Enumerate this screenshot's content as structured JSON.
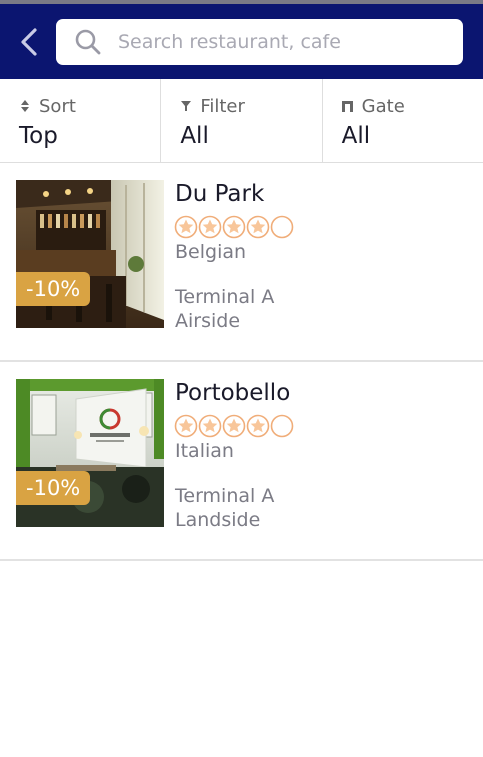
{
  "header": {
    "back_icon": "chevron-left-icon",
    "search_icon": "search-icon",
    "search_placeholder": "Search restaurant, cafe",
    "search_value": "",
    "bg_color": "#0b1570"
  },
  "filters": {
    "sort": {
      "label": "Sort",
      "value": "Top",
      "icon": "sort-icon"
    },
    "filter": {
      "label": "Filter",
      "value": "All",
      "icon": "filter-icon"
    },
    "gate": {
      "label": "Gate",
      "value": "All",
      "icon": "gate-icon"
    }
  },
  "restaurants": [
    {
      "name": "Du Park",
      "rating": 4,
      "rating_max": 5,
      "cuisine": "Belgian",
      "terminal": "Terminal A",
      "side": "Airside",
      "discount": "-10%"
    },
    {
      "name": "Portobello",
      "rating": 4,
      "rating_max": 5,
      "cuisine": "Italian",
      "terminal": "Terminal A",
      "side": "Landside",
      "discount": "-10%"
    }
  ],
  "colors": {
    "accent": "#d9a343",
    "star_fill": "#f8c69a",
    "star_stroke": "#f0ad79"
  }
}
